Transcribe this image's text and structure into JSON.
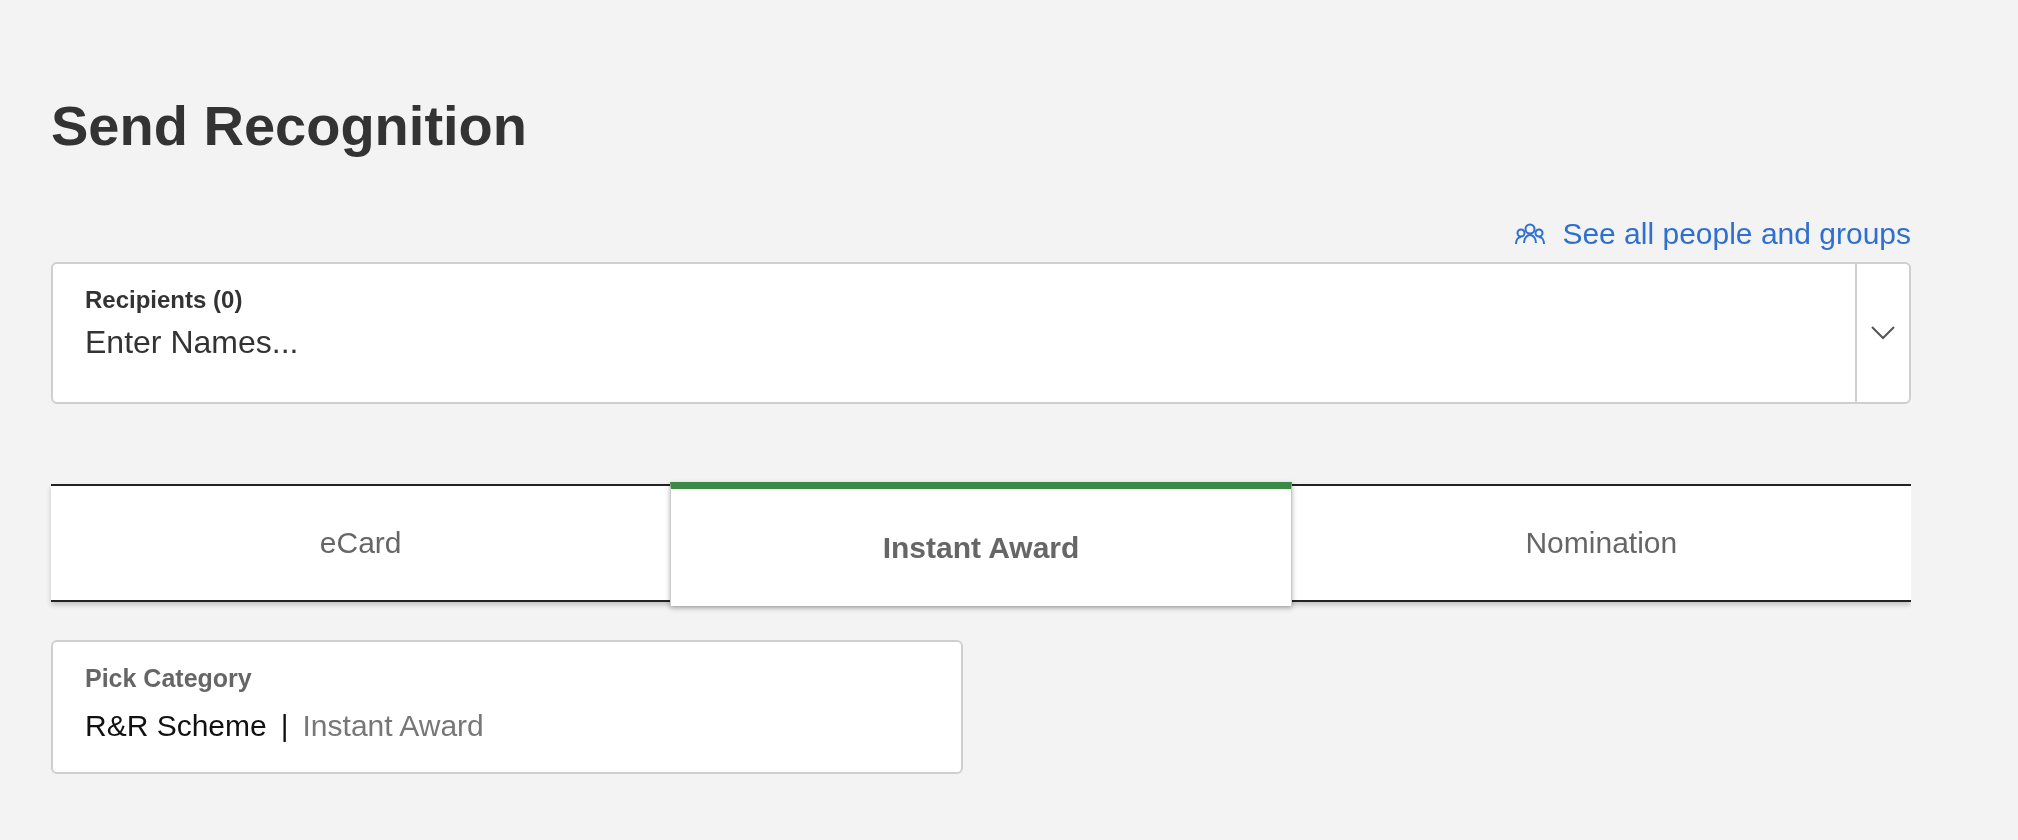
{
  "page": {
    "title": "Send Recognition"
  },
  "people_link": {
    "label": "See all people and groups"
  },
  "recipients": {
    "label": "Recipients (0)",
    "placeholder": "Enter Names..."
  },
  "tabs": [
    {
      "label": "eCard",
      "selected": false
    },
    {
      "label": "Instant Award",
      "selected": true
    },
    {
      "label": "Nomination",
      "selected": false
    }
  ],
  "category": {
    "label": "Pick Category",
    "scheme": "R&R Scheme",
    "separator": "|",
    "value": "Instant Award"
  }
}
